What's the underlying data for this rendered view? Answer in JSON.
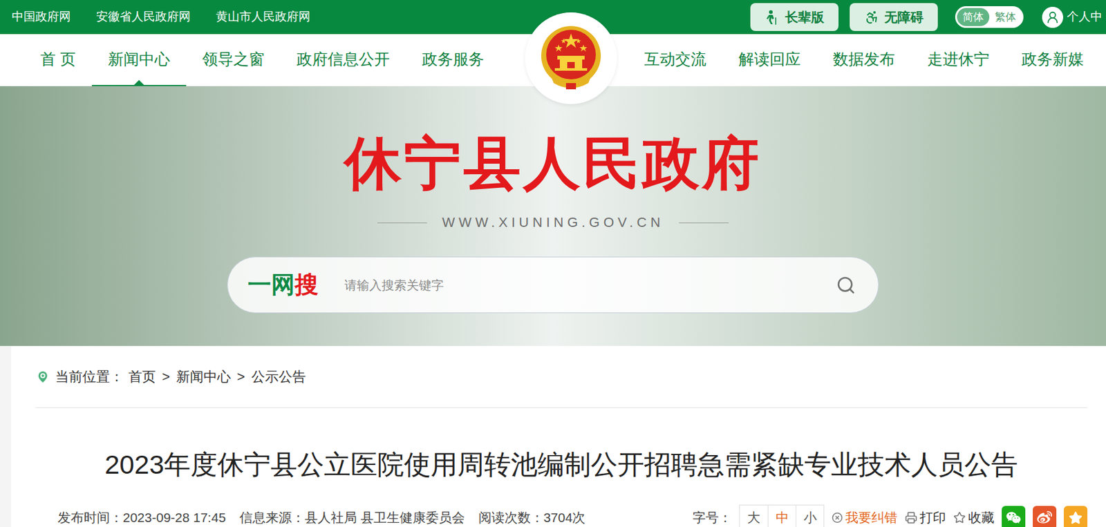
{
  "top_bar": {
    "links": [
      "中国政府网",
      "安徽省人民政府网",
      "黄山市人民政府网"
    ],
    "elder_mode": "长辈版",
    "accessibility": "无障碍",
    "scripts": [
      {
        "label": "简体",
        "selected": true
      },
      {
        "label": "繁体",
        "selected": false
      }
    ],
    "personal": "个人中"
  },
  "nav_left": [
    {
      "label": "首 页",
      "selected": false
    },
    {
      "label": "新闻中心",
      "selected": true
    },
    {
      "label": "领导之窗",
      "selected": false
    },
    {
      "label": "政府信息公开",
      "selected": false
    },
    {
      "label": "政务服务",
      "selected": false
    }
  ],
  "nav_right": [
    {
      "label": "互动交流",
      "selected": false
    },
    {
      "label": "解读回应",
      "selected": false
    },
    {
      "label": "数据发布",
      "selected": false
    },
    {
      "label": "走进休宁",
      "selected": false
    },
    {
      "label": "政务新媒",
      "selected": false
    }
  ],
  "banner": {
    "title": "休宁县人民政府",
    "domain": "WWW.XIUNING.GOV.CN"
  },
  "search": {
    "brand_a": "一网",
    "brand_b": "搜",
    "placeholder": "请输入搜索关键字"
  },
  "breadcrumb": {
    "label": "当前位置：",
    "items": [
      "首页",
      "新闻中心",
      "公示公告"
    ],
    "separator": ">"
  },
  "article": {
    "title": "2023年度休宁县公立医院使用周转池编制公开招聘急需紧缺专业技术人员公告",
    "meta": [
      "发布时间：2023-09-28 17:45",
      "信息来源：县人社局 县卫生健康委员会",
      "阅读次数：3704次"
    ],
    "font_size_label": "字号：",
    "font_sizes": [
      {
        "label": "大",
        "selected": false
      },
      {
        "label": "中",
        "selected": true
      },
      {
        "label": "小",
        "selected": false
      }
    ],
    "actions": [
      {
        "label": "我要纠错",
        "color": "#e2661c"
      },
      {
        "label": "打印",
        "color": "#333333"
      },
      {
        "label": "收藏",
        "color": "#333333"
      }
    ]
  }
}
